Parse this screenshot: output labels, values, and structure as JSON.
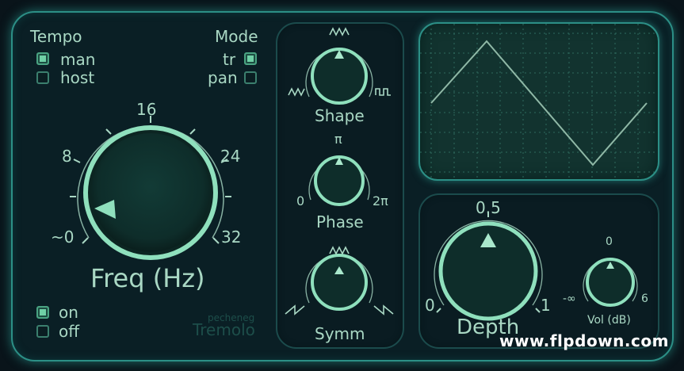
{
  "tempo": {
    "title": "Tempo",
    "options": [
      {
        "label": "man",
        "checked": true
      },
      {
        "label": "host",
        "checked": false
      }
    ]
  },
  "mode": {
    "title": "Mode",
    "options": [
      {
        "label": "tr",
        "checked": true
      },
      {
        "label": "pan",
        "checked": false
      }
    ]
  },
  "freq": {
    "label": "Freq (Hz)",
    "ticks": [
      "~0",
      "8",
      "16",
      "24",
      "32"
    ]
  },
  "shape": {
    "label": "Shape",
    "left_symbol": "sine-wave-icon",
    "top_symbol": "triangle-wave-icon",
    "right_symbol": "square-wave-icon"
  },
  "phase": {
    "label": "Phase",
    "min": "0",
    "mid": "π",
    "max": "2π"
  },
  "symm": {
    "label": "Symm",
    "left_symbol": "saw-up-icon",
    "top_symbol": "triangle-wave-icon",
    "right_symbol": "saw-down-icon"
  },
  "power": {
    "options": [
      {
        "label": "on",
        "checked": true
      },
      {
        "label": "off",
        "checked": false
      }
    ]
  },
  "brand": {
    "vendor": "pecheneg",
    "product": "Tremolo"
  },
  "scope": {
    "waveform": "triangle"
  },
  "depth": {
    "label": "Depth",
    "min": "0",
    "mid": "0.5",
    "max": "1"
  },
  "vol": {
    "label": "Vol (dB)",
    "min": "-∞",
    "mid": "0",
    "max": "6"
  },
  "watermark": "www.flpdown.com",
  "colors": {
    "accent": "#6fd0a6",
    "text": "#a9d8c4",
    "border": "#2c8f86",
    "background": "#0a1f25"
  }
}
